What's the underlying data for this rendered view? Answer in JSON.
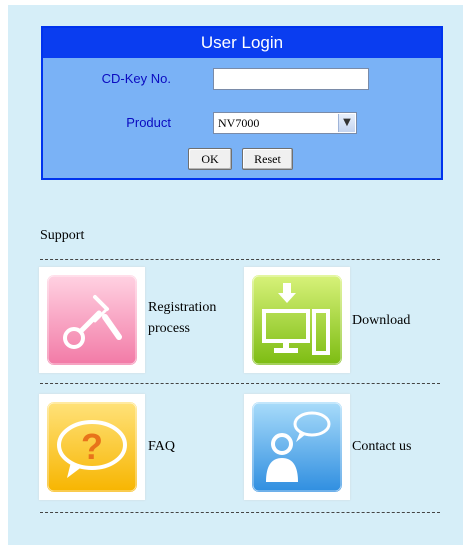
{
  "login": {
    "title": "User Login",
    "cdkey_label": "CD-Key No.",
    "cdkey_value": "",
    "product_label": "Product",
    "product_value": "NV7000",
    "ok_label": "OK",
    "reset_label": "Reset"
  },
  "support": {
    "title": "Support",
    "items": [
      {
        "label_line1": "Registration",
        "label_line2": "process",
        "icon": "wrench-screwdriver-icon"
      },
      {
        "label": "Download",
        "icon": "download-computer-icon"
      },
      {
        "label": "FAQ",
        "icon": "question-bubble-icon"
      },
      {
        "label": "Contact us",
        "icon": "contact-person-icon"
      }
    ]
  },
  "colors": {
    "panel_bg": "#d6eef8",
    "login_header": "#0a3df0",
    "login_body": "#7ab2f6",
    "label_text": "#0b0bc0"
  }
}
